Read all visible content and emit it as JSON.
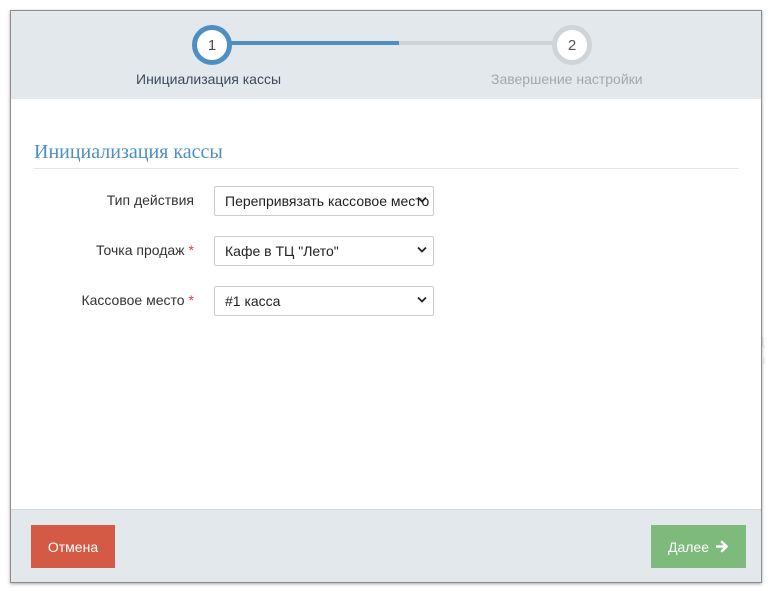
{
  "wizard": {
    "steps": [
      {
        "number": "1",
        "label": "Инициализация кассы",
        "state": "active"
      },
      {
        "number": "2",
        "label": "Завершение настройки",
        "state": "pending"
      }
    ],
    "progress": 0.5
  },
  "form": {
    "title": "Инициализация кассы",
    "fields": [
      {
        "label": "Тип действия",
        "required": false,
        "value": "Перепривязать кассовое место"
      },
      {
        "label": "Точка продаж",
        "required": true,
        "value": "Кафе в ТЦ \"Лето\""
      },
      {
        "label": "Кассовое место",
        "required": true,
        "value": "#1 касса"
      }
    ],
    "required_mark": "*"
  },
  "footer": {
    "cancel_label": "Отмена",
    "next_label": "Далее"
  },
  "colors": {
    "accent": "#4e8fc3",
    "cancel": "#d45a45",
    "next": "#7dba7b",
    "required": "#d9403a",
    "header_bg": "#e3e8ec"
  },
  "icons": [
    "chevron-down-icon",
    "arrow-right-icon"
  ]
}
